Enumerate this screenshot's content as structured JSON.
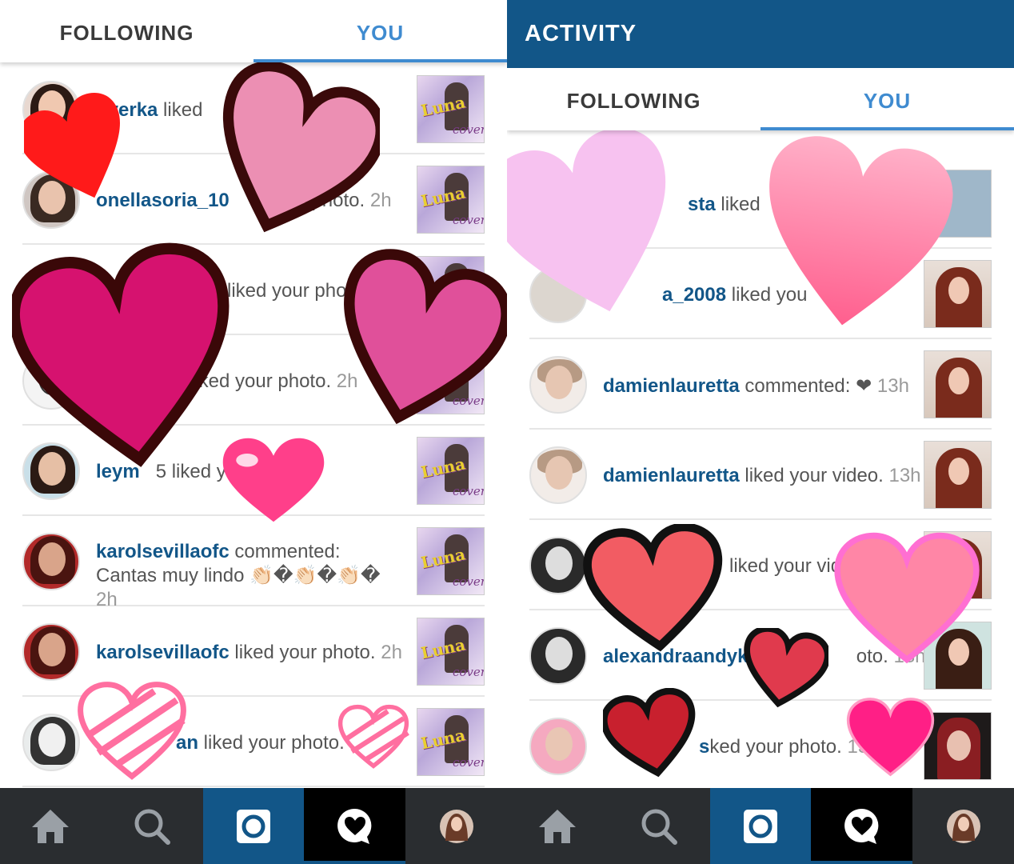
{
  "left": {
    "tabs": {
      "following": "FOLLOWING",
      "you": "YOU"
    },
    "rows": [
      {
        "user": "overka",
        "action": " liked",
        "time": ""
      },
      {
        "user": "onellasoria_10",
        "action": " ",
        "tail": "photo.",
        "time": "2h"
      },
      {
        "user": "",
        "action": "liked your photo",
        "time": ""
      },
      {
        "user": "",
        "action": "liked your photo.",
        "time": "2h"
      },
      {
        "user": "leym",
        "action": "5 liked y",
        "time": ""
      },
      {
        "user": "karolsevillaofc",
        "action": " commented: Cantas muy lindo 👏🏻�👏🏻�👏🏻�",
        "time": "2h"
      },
      {
        "user": "karolsevillaofc",
        "action": " liked your photo.",
        "time": "2h"
      },
      {
        "user": "an",
        "action": " liked your photo. 2",
        "time": ""
      }
    ]
  },
  "right": {
    "header": {
      "title": "ACTIVITY"
    },
    "tabs": {
      "following": "FOLLOWING",
      "you": "YOU"
    },
    "rows": [
      {
        "user": "sta",
        "action": " liked",
        "time": ""
      },
      {
        "user": "a_2008",
        "action": " liked you",
        "time": ""
      },
      {
        "user": "damienlauretta",
        "action": " commented: ❤",
        "time": "13h"
      },
      {
        "user": "damienlauretta",
        "action": " liked your video.",
        "time": "13h"
      },
      {
        "user": "",
        "action": "liked your vide",
        "time": ""
      },
      {
        "user": "alexandraandyk",
        "action": " lik",
        "tail": "oto.",
        "time": "13h"
      },
      {
        "user": "s",
        "action": "ked your photo.",
        "time": "13h"
      }
    ]
  },
  "nav": {
    "icons": [
      "home-icon",
      "search-icon",
      "camera-icon",
      "activity-heart-icon",
      "profile-icon"
    ]
  },
  "colors": {
    "brand_blue": "#125688",
    "tab_active": "#3f8bd0",
    "nav_bg": "#2a2d30",
    "username": "#125688"
  }
}
